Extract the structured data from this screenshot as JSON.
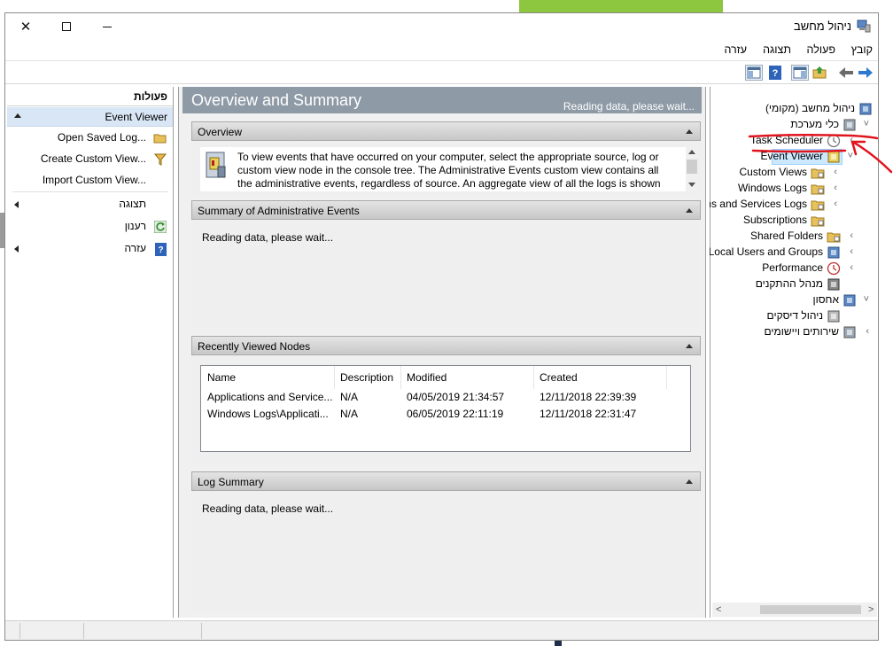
{
  "window": {
    "title": "ניהול מחשב",
    "title_icon": "computer-management-icon"
  },
  "menu": {
    "items": [
      "קובץ",
      "פעולה",
      "תצוגה",
      "עזרה"
    ]
  },
  "toolbar": {
    "icons": [
      "forward-arrow-icon",
      "back-arrow-icon",
      "up-folder-icon",
      "show-hide-tree-icon",
      "help-icon",
      "show-hide-action-pane-icon"
    ]
  },
  "tree": {
    "items": [
      {
        "label": "ניהול מחשב (מקומי)",
        "icon": "computer-management-icon"
      },
      {
        "label": "כלי מערכת",
        "icon": "tools-icon",
        "expander": "˅"
      },
      {
        "label": "Task Scheduler",
        "icon": "clock-icon",
        "expander": "‹"
      },
      {
        "label": "Event Viewer",
        "icon": "event-viewer-icon",
        "expander": "˅"
      },
      {
        "label": "Custom Views",
        "icon": "folder-icon",
        "expander": "‹"
      },
      {
        "label": "Windows Logs",
        "icon": "folder-icon",
        "expander": "‹"
      },
      {
        "label": "ns and Services Logs",
        "icon": "folder-icon",
        "expander": "‹"
      },
      {
        "label": "Subscriptions",
        "icon": "subscriptions-icon"
      },
      {
        "label": "Shared Folders",
        "icon": "shared-folders-icon",
        "expander": "‹"
      },
      {
        "label": "Local Users and Groups",
        "icon": "users-icon",
        "expander": "‹"
      },
      {
        "label": "Performance",
        "icon": "performance-icon",
        "expander": "‹"
      },
      {
        "label": "מנהל ההתקנים",
        "icon": "device-manager-icon"
      },
      {
        "label": "אחסון",
        "icon": "storage-icon",
        "expander": "˅"
      },
      {
        "label": "ניהול דיסקים",
        "icon": "disk-management-icon"
      },
      {
        "label": "שירותים ויישומים",
        "icon": "services-icon",
        "expander": "‹"
      }
    ]
  },
  "center": {
    "header_title": "Overview and Summary",
    "header_status": "Reading data, please wait...",
    "overview": {
      "title": "Overview",
      "text": "To view events that have occurred on your computer, select the appropriate source, log or custom view node in the console tree. The Administrative Events custom view contains all the administrative events, regardless of source. An aggregate view of all the logs is shown"
    },
    "summary_admin": {
      "title": "Summary of Administrative Events",
      "text": "Reading data, please wait..."
    },
    "recent_nodes": {
      "title": "Recently Viewed Nodes",
      "columns": [
        "Name",
        "Description",
        "Modified",
        "Created"
      ],
      "rows": [
        [
          "Applications and Service...",
          "N/A",
          "04/05/2019 21:34:57",
          "12/11/2018 22:39:39"
        ],
        [
          "Windows Logs\\Applicati...",
          "N/A",
          "06/05/2019 22:11:19",
          "12/11/2018 22:31:47"
        ]
      ]
    },
    "log_summary": {
      "title": "Log Summary",
      "text": "Reading data, please wait..."
    }
  },
  "actions": {
    "header": "פעולות",
    "section": "Event Viewer",
    "items": [
      {
        "label": "Open Saved Log...",
        "icon": "open-folder-icon"
      },
      {
        "label": "Create Custom View...",
        "icon": "filter-icon"
      },
      {
        "label": "Import Custom View...",
        "icon": ""
      },
      {
        "label": "תצוגה",
        "icon": "",
        "submenu": true
      },
      {
        "label": "רענון",
        "icon": "refresh-icon"
      },
      {
        "label": "עזרה",
        "icon": "help-icon",
        "submenu": true
      }
    ]
  },
  "colors": {
    "header_bar": "#8e9aa6",
    "selection": "#d8e6f5",
    "annotation": "#e0141e",
    "tree_selection": "#cce8ff"
  }
}
